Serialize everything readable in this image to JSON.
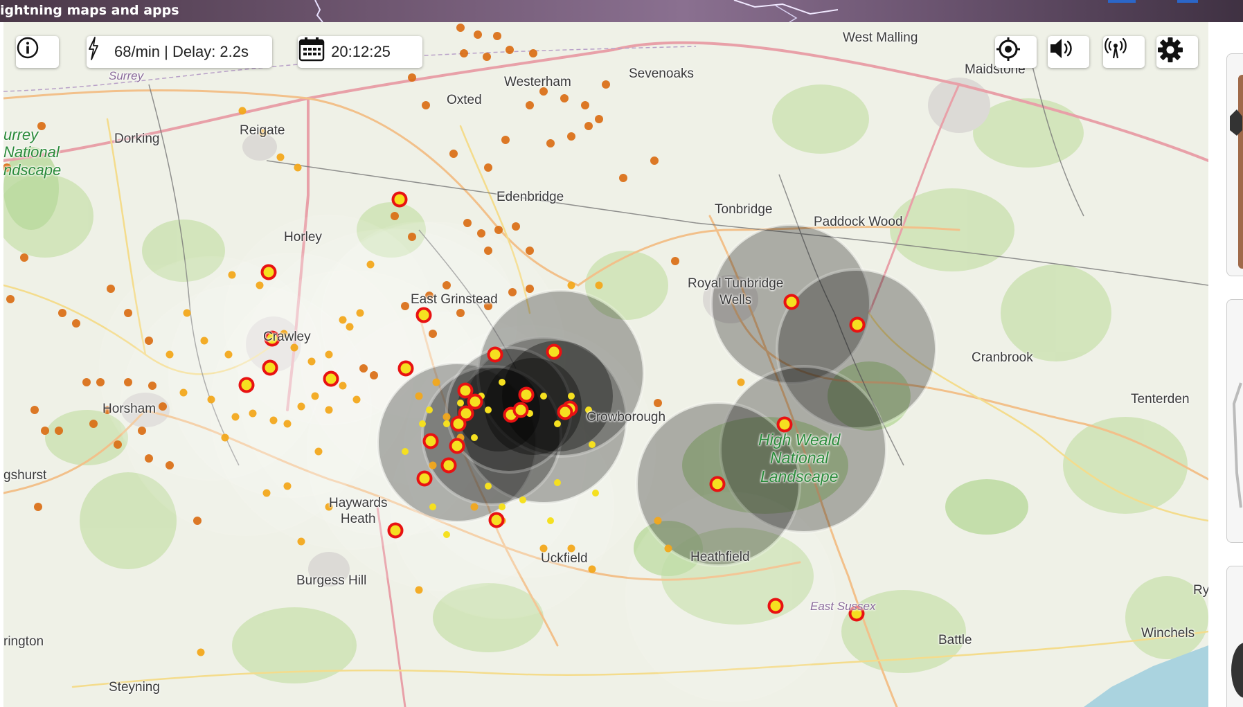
{
  "app": {
    "title": "ightning maps and apps"
  },
  "toolbar": {
    "info_icon": "info-icon",
    "rate_text": "68/min | Delay: 2.2s",
    "time_text": "20:12:25",
    "locate_icon": "crosshair-icon",
    "sound_icon": "speaker-icon",
    "stations_icon": "antenna-icon",
    "settings_icon": "gear-icon"
  },
  "map": {
    "places": {
      "west_malling": "West Malling",
      "maidstone": "Maidstone",
      "surrey": "Surrey",
      "sevenoaks": "Sevenoaks",
      "westerham": "Westerham",
      "oxted": "Oxted",
      "reigate": "Reigate",
      "dorking": "Dorking",
      "surrey_nl": "urrey\nNational\nndscape",
      "edenbridge": "Edenbridge",
      "tonbridge": "Tonbridge",
      "paddock_wood": "Paddock Wood",
      "horley": "Horley",
      "royal_tunbridge_wells": "Royal Tunbridge\nWells",
      "east_grinstead": "East Grinstead",
      "crawley": "Crawley",
      "cranbrook": "Cranbrook",
      "horsham": "Horsham",
      "crowborough": "Crowborough",
      "tenterden": "Tenterden",
      "high_weald": "High Weald\nNational\nLandscape",
      "billingshurst": "gshurst",
      "haywards_heath": "Haywards\nHeath",
      "uckfield": "Uckfield",
      "heathfield": "Heathfield",
      "burgess_hill": "Burgess Hill",
      "east_sussex": "East Sussex",
      "rye": "Ry",
      "storrington": "rington",
      "battle": "Battle",
      "winchelsea": "Winchels",
      "steyning": "Steyning"
    }
  }
}
